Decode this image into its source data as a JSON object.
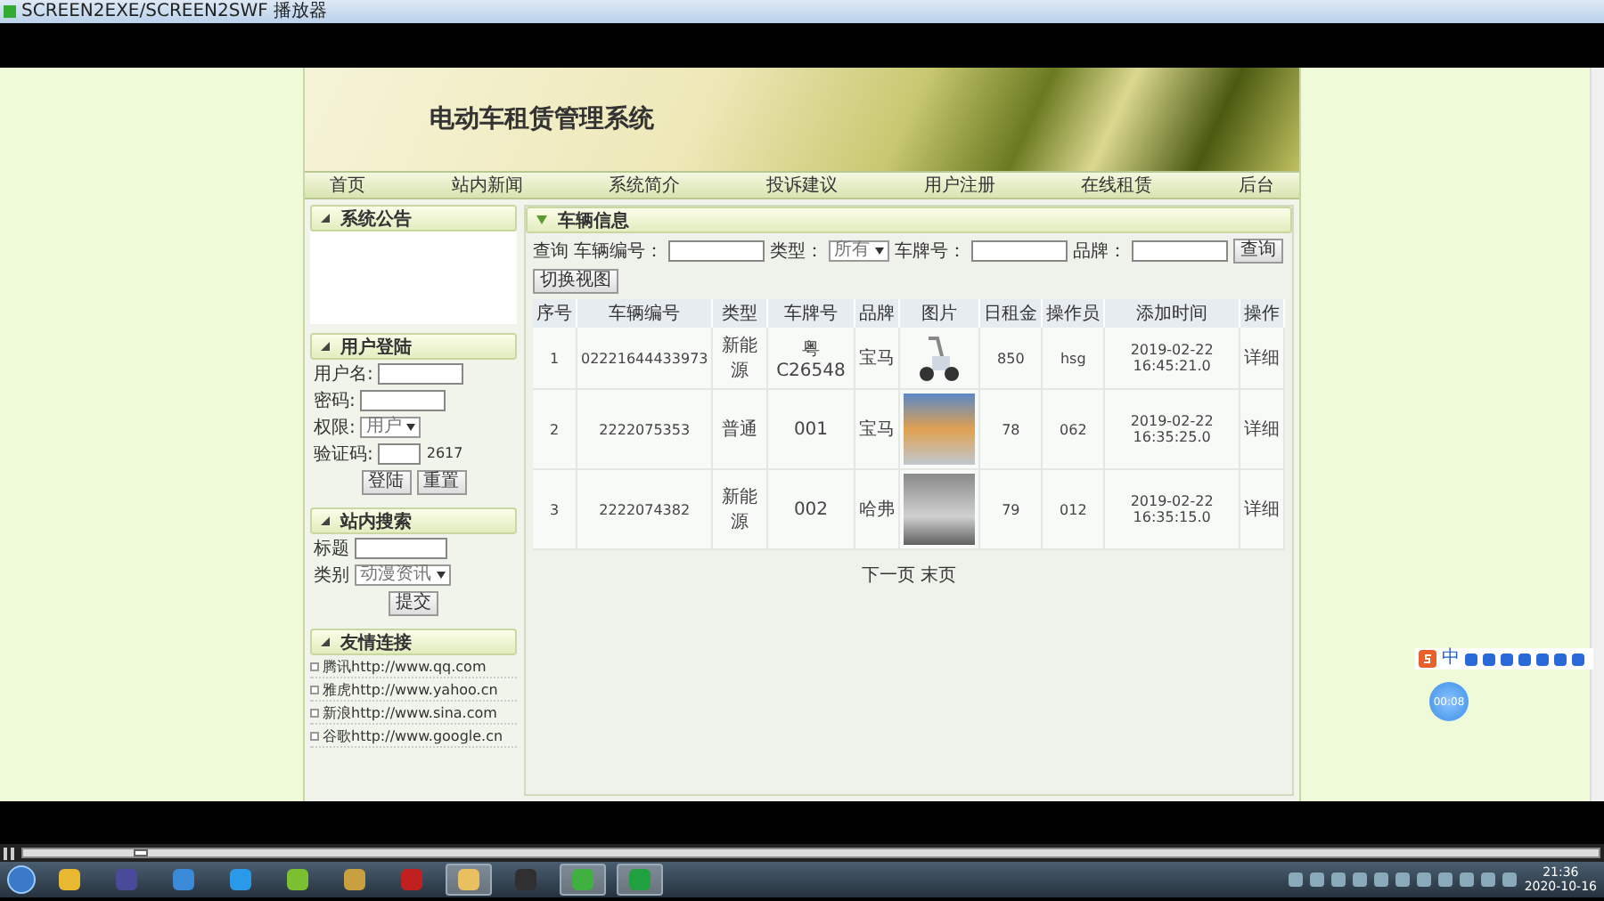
{
  "window": {
    "title": "SCREEN2EXE/SCREEN2SWF 播放器"
  },
  "site": {
    "title": "电动车租赁管理系统",
    "nav": [
      {
        "label": "首页"
      },
      {
        "label": "站内新闻"
      },
      {
        "label": "系统简介"
      },
      {
        "label": "投诉建议"
      },
      {
        "label": "用户注册"
      },
      {
        "label": "在线租赁"
      },
      {
        "label": "后台"
      }
    ],
    "sidebar": [
      {
        "kind": "notice",
        "title": "系统公告"
      },
      {
        "kind": "login",
        "title": "用户登陆",
        "fields": [
          {
            "kind": "input",
            "label": "用户名:"
          },
          {
            "kind": "input",
            "label": "密码:"
          },
          {
            "kind": "select",
            "label": "权限:",
            "value": "用户"
          },
          {
            "kind": "captcha",
            "label": "验证码:",
            "code": "2617"
          }
        ],
        "buttons": [
          "登陆",
          "重置"
        ]
      },
      {
        "kind": "search",
        "title": "站内搜索",
        "fields": [
          {
            "kind": "input",
            "label": "标题"
          },
          {
            "kind": "select",
            "label": "类别",
            "value": "动漫资讯"
          }
        ],
        "buttons": [
          "提交"
        ]
      },
      {
        "kind": "links",
        "title": "友情连接",
        "links": [
          "腾讯http://www.qq.com",
          "雅虎http://www.yahoo.cn",
          "新浪http://www.sina.com",
          "谷歌http://www.google.cn"
        ]
      }
    ],
    "main": {
      "title": "车辆信息",
      "query": {
        "label": "查询",
        "fields": [
          {
            "kind": "input",
            "label": "车辆编号："
          },
          {
            "kind": "select",
            "label": "类型：",
            "value": "所有"
          },
          {
            "kind": "input",
            "label": "车牌号："
          },
          {
            "kind": "input",
            "label": "品牌："
          }
        ],
        "buttons": [
          "查询",
          "切换视图"
        ]
      },
      "table": {
        "columns": [
          "序号",
          "车辆编号",
          "类型",
          "车牌号",
          "品牌",
          "图片",
          "日租金",
          "操作员",
          "添加时间",
          "操作"
        ],
        "rows": [
          {
            "cells": [
              "1",
              "02221644433973",
              "新能源",
              "粤C26548",
              "宝马",
              {
                "kind": "drawing"
              },
              "850",
              "hsg",
              "2019-02-22 16:45:21.0",
              "详细"
            ]
          },
          {
            "cells": [
              "2",
              "2222075353",
              "普通",
              "001",
              "宝马",
              {
                "kind": "photo"
              },
              "78",
              "062",
              "2019-02-22 16:35:25.0",
              "详细"
            ]
          },
          {
            "cells": [
              "3",
              "2222074382",
              "新能源",
              "002",
              "哈弗",
              {
                "kind": "photo"
              },
              "79",
              "012",
              "2019-02-22 16:35:15.0",
              "详细"
            ]
          }
        ]
      },
      "pagination": [
        "下一页",
        "末页"
      ]
    }
  },
  "ime": {
    "mode": "中",
    "timer": "00:08"
  },
  "player": {
    "level": 0.07
  },
  "taskbar": {
    "apps": [
      {
        "color": "#e8b830",
        "active": false
      },
      {
        "color": "#4a4a9a",
        "active": false
      },
      {
        "color": "#3a8ad8",
        "active": false
      },
      {
        "color": "#2a9ae8",
        "active": false
      },
      {
        "color": "#7ac030",
        "active": false
      },
      {
        "color": "#c8a040",
        "active": false
      },
      {
        "color": "#c02020",
        "active": false
      },
      {
        "color": "#e8c060",
        "active": true
      },
      {
        "color": "#303030",
        "active": false
      },
      {
        "color": "#40b040",
        "active": true
      },
      {
        "color": "#20a040",
        "active": true
      }
    ],
    "time": "21:36",
    "date": "2020-10-16"
  }
}
